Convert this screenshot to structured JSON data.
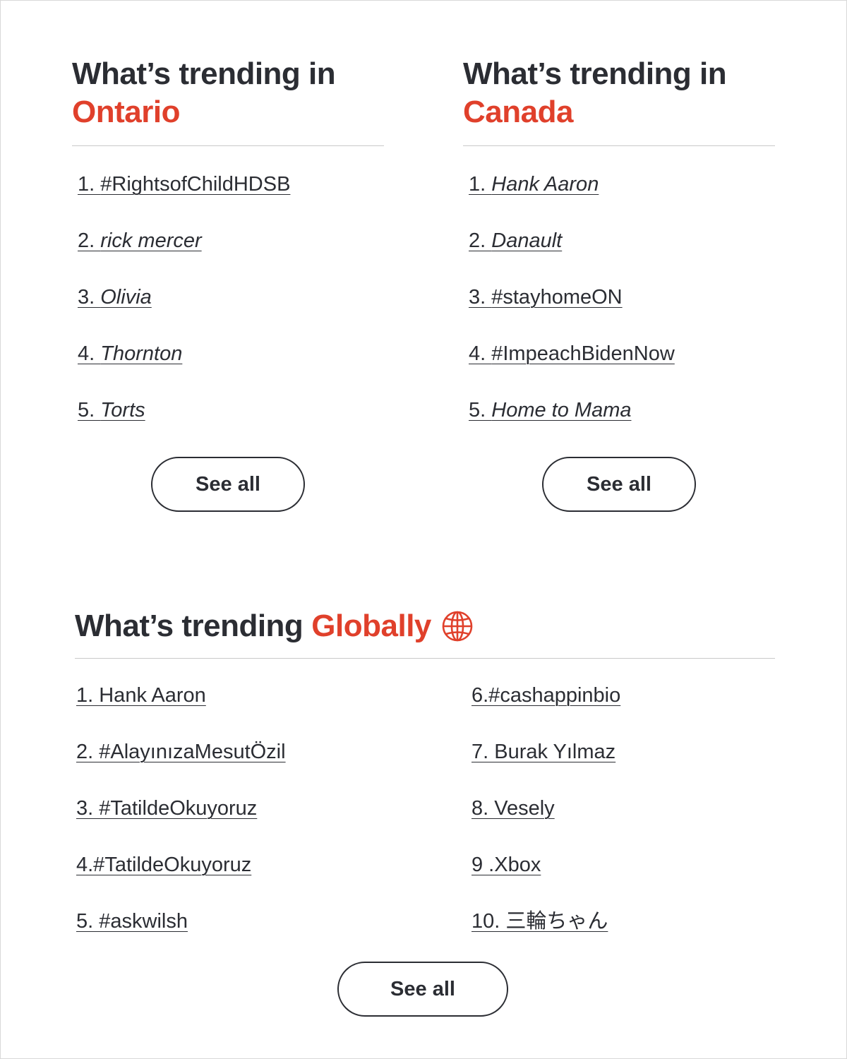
{
  "ontario": {
    "heading_lead": "What’s trending in",
    "heading_accent": "Ontario",
    "items": [
      {
        "num": "1. ",
        "text": "#RightsofChildHDSB"
      },
      {
        "num": "2. ",
        "text": "rick mercer"
      },
      {
        "num": "3. ",
        "text": "Olivia"
      },
      {
        "num": "4. ",
        "text": "Thornton"
      },
      {
        "num": "5. ",
        "text": "Torts"
      }
    ],
    "see_all": "See all"
  },
  "canada": {
    "heading_lead": "What’s trending in",
    "heading_accent": "Canada",
    "items": [
      {
        "num": "1. ",
        "text": "Hank Aaron"
      },
      {
        "num": "2. ",
        "text": "Danault"
      },
      {
        "num": "3. ",
        "text": "#stayhomeON"
      },
      {
        "num": "4. ",
        "text": "#ImpeachBidenNow"
      },
      {
        "num": "5. ",
        "text": "Home to Mama"
      }
    ],
    "see_all": "See all"
  },
  "global": {
    "heading_lead": "What’s trending",
    "heading_accent": "Globally",
    "icon": "globe-icon",
    "left_items": [
      "1. Hank Aaron",
      "2. #AlayınızaMesutÖzil",
      "3. #TatildeOkuyoruz",
      "4.#TatildeOkuyoruz",
      "5. #askwilsh"
    ],
    "right_items": [
      "6.#cashappinbio",
      "7. Burak Yılmaz",
      "8. Vesely",
      "9 .Xbox",
      "10. 三輪ちゃん"
    ],
    "see_all": "See all"
  },
  "colors": {
    "accent": "#e0402b",
    "text": "#2b2d33",
    "divider": "#c9c9c9"
  }
}
